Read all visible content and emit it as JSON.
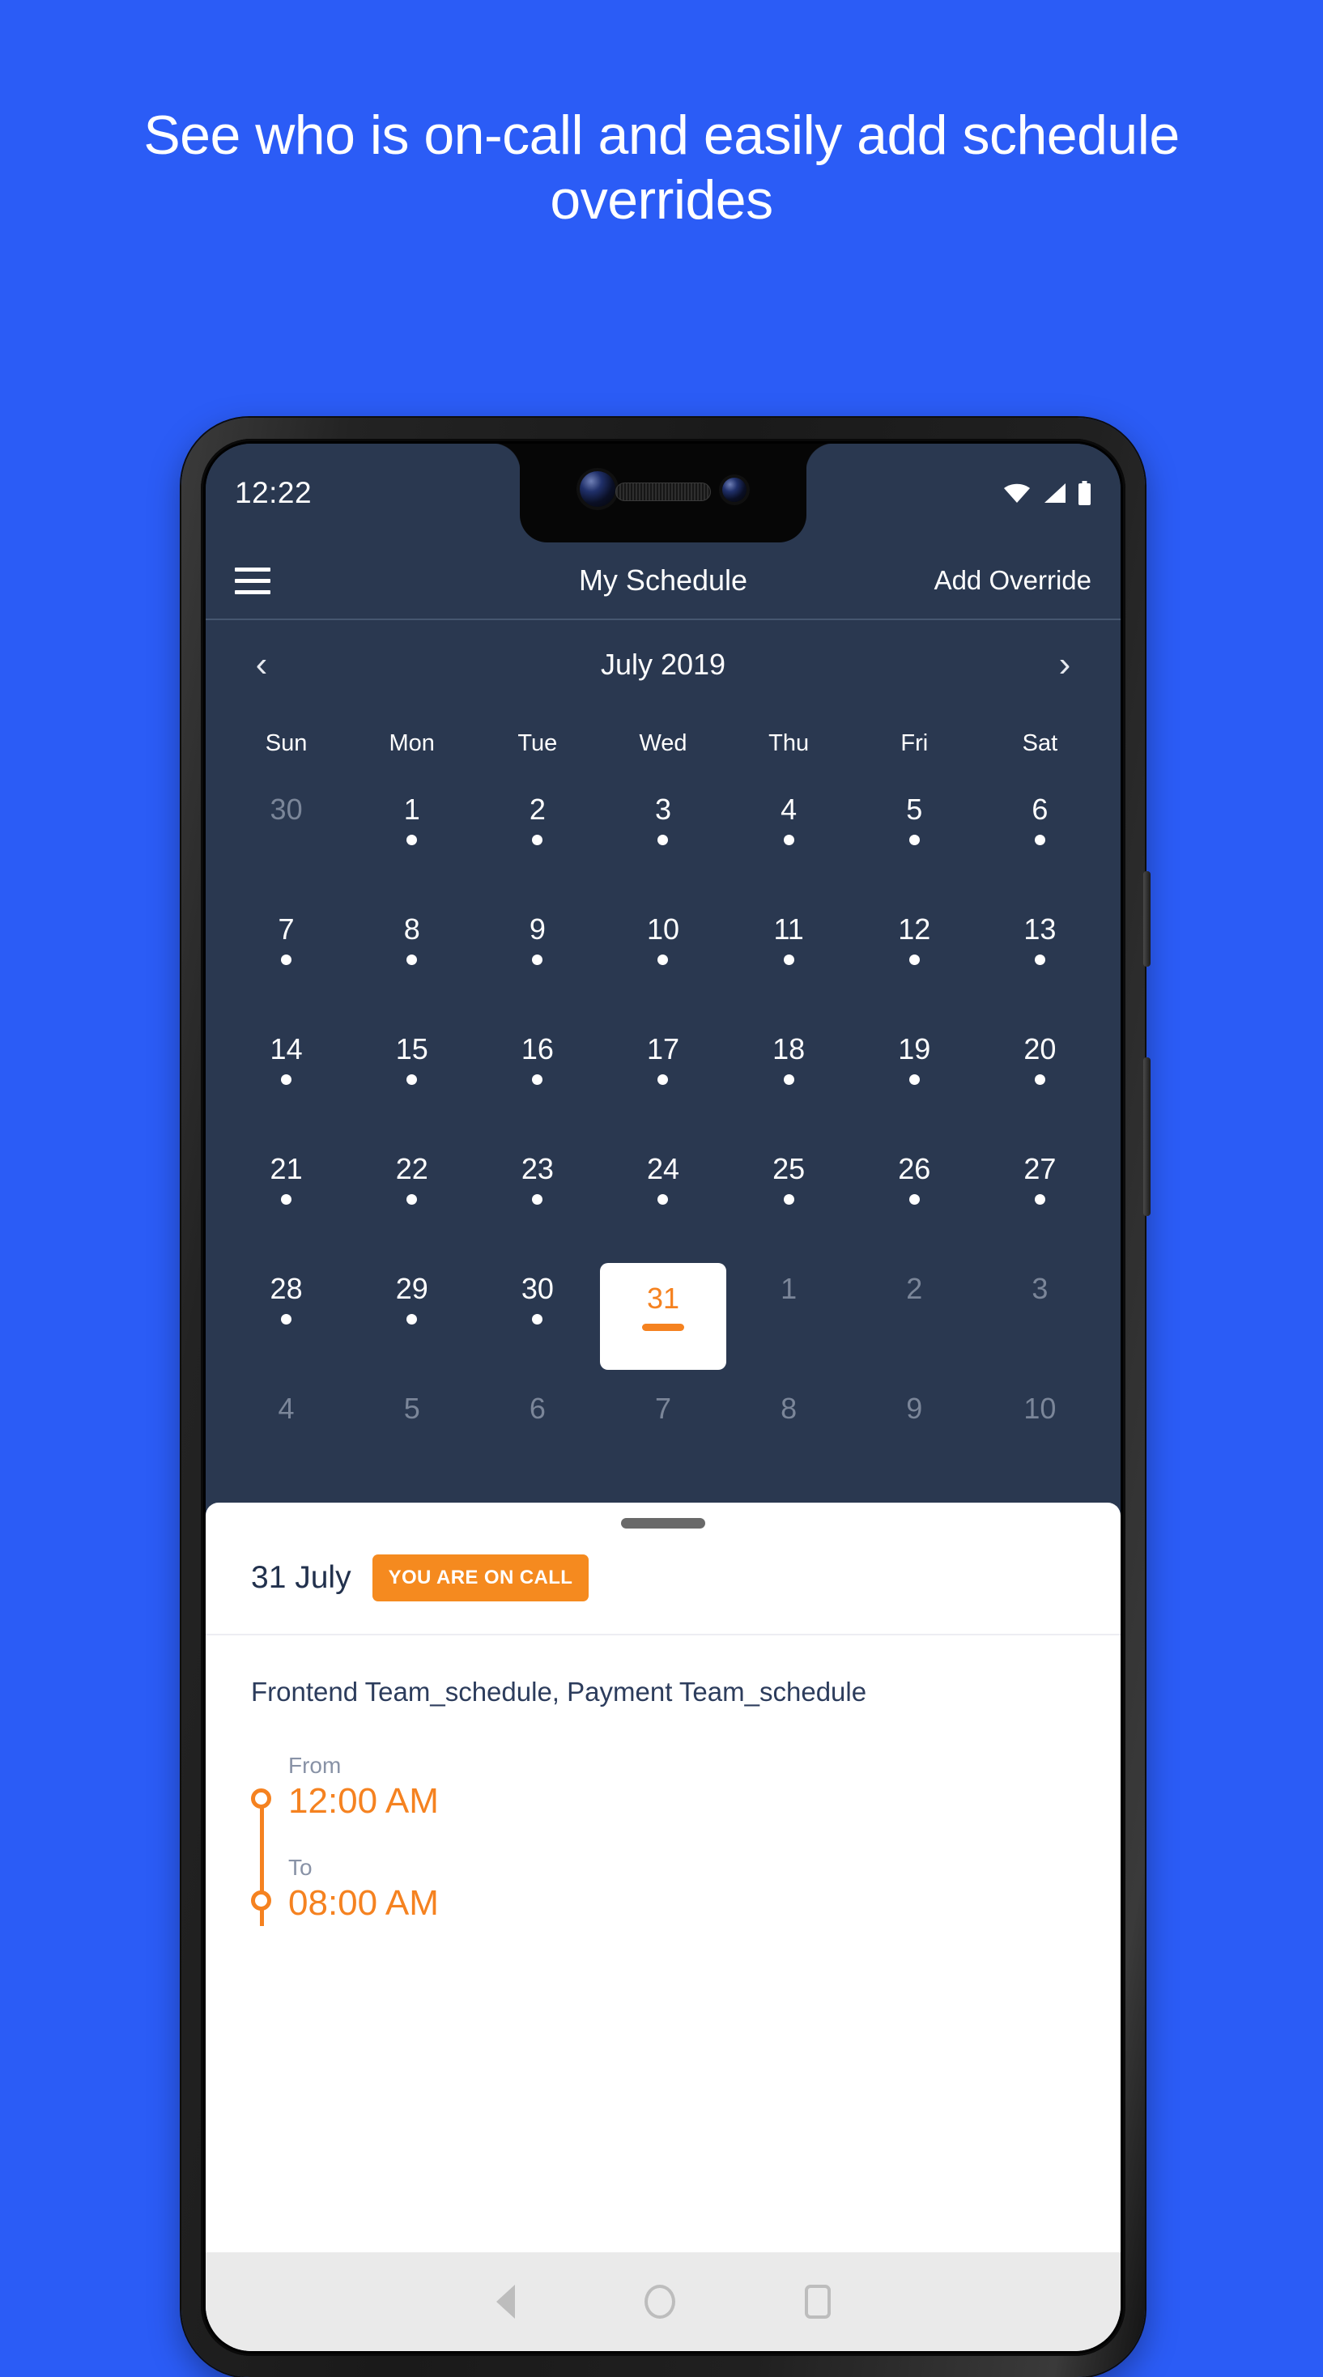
{
  "promo": {
    "heading": "See who is on-call and easily add schedule overrides",
    "background_color": "#2b5cf6"
  },
  "phone": {
    "status_bar": {
      "time": "12:22",
      "icons": [
        "wifi-icon",
        "signal-icon",
        "battery-icon"
      ]
    },
    "app_bar": {
      "menu_icon": "hamburger-menu-icon",
      "title": "My Schedule",
      "action_label": "Add Override"
    },
    "calendar": {
      "prev_label": "‹",
      "next_label": "›",
      "month_label": "July 2019",
      "weekdays": [
        "Sun",
        "Mon",
        "Tue",
        "Wed",
        "Thu",
        "Fri",
        "Sat"
      ],
      "selected_day": "31",
      "accent_color": "#f58220",
      "surface_color": "#2a3850",
      "weeks": [
        [
          {
            "day": "30",
            "muted": true,
            "dot": false
          },
          {
            "day": "1",
            "muted": false,
            "dot": true
          },
          {
            "day": "2",
            "muted": false,
            "dot": true
          },
          {
            "day": "3",
            "muted": false,
            "dot": true
          },
          {
            "day": "4",
            "muted": false,
            "dot": true
          },
          {
            "day": "5",
            "muted": false,
            "dot": true
          },
          {
            "day": "6",
            "muted": false,
            "dot": true
          }
        ],
        [
          {
            "day": "7",
            "muted": false,
            "dot": true
          },
          {
            "day": "8",
            "muted": false,
            "dot": true
          },
          {
            "day": "9",
            "muted": false,
            "dot": true
          },
          {
            "day": "10",
            "muted": false,
            "dot": true
          },
          {
            "day": "11",
            "muted": false,
            "dot": true
          },
          {
            "day": "12",
            "muted": false,
            "dot": true
          },
          {
            "day": "13",
            "muted": false,
            "dot": true
          }
        ],
        [
          {
            "day": "14",
            "muted": false,
            "dot": true
          },
          {
            "day": "15",
            "muted": false,
            "dot": true
          },
          {
            "day": "16",
            "muted": false,
            "dot": true
          },
          {
            "day": "17",
            "muted": false,
            "dot": true
          },
          {
            "day": "18",
            "muted": false,
            "dot": true
          },
          {
            "day": "19",
            "muted": false,
            "dot": true
          },
          {
            "day": "20",
            "muted": false,
            "dot": true
          }
        ],
        [
          {
            "day": "21",
            "muted": false,
            "dot": true
          },
          {
            "day": "22",
            "muted": false,
            "dot": true
          },
          {
            "day": "23",
            "muted": false,
            "dot": true
          },
          {
            "day": "24",
            "muted": false,
            "dot": true
          },
          {
            "day": "25",
            "muted": false,
            "dot": true
          },
          {
            "day": "26",
            "muted": false,
            "dot": true
          },
          {
            "day": "27",
            "muted": false,
            "dot": true
          }
        ],
        [
          {
            "day": "28",
            "muted": false,
            "dot": true
          },
          {
            "day": "29",
            "muted": false,
            "dot": true
          },
          {
            "day": "30",
            "muted": false,
            "dot": true
          },
          {
            "day": "31",
            "muted": false,
            "dot": false,
            "selected": true
          },
          {
            "day": "1",
            "muted": true,
            "dot": false
          },
          {
            "day": "2",
            "muted": true,
            "dot": false
          },
          {
            "day": "3",
            "muted": true,
            "dot": false
          }
        ],
        [
          {
            "day": "4",
            "muted": true,
            "dot": false
          },
          {
            "day": "5",
            "muted": true,
            "dot": false
          },
          {
            "day": "6",
            "muted": true,
            "dot": false
          },
          {
            "day": "7",
            "muted": true,
            "dot": false
          },
          {
            "day": "8",
            "muted": true,
            "dot": false
          },
          {
            "day": "9",
            "muted": true,
            "dot": false
          },
          {
            "day": "10",
            "muted": true,
            "dot": false
          }
        ]
      ]
    },
    "sheet": {
      "date_label": "31 July",
      "badge_label": "YOU ARE ON CALL",
      "schedules": "Frontend Team_schedule, Payment Team_schedule",
      "from_label": "From",
      "from_time": "12:00 AM",
      "to_label": "To",
      "to_time": "08:00 AM"
    },
    "nav_bar": {
      "back": "back-triangle-icon",
      "home": "home-circle-icon",
      "recents": "recents-square-icon"
    }
  }
}
